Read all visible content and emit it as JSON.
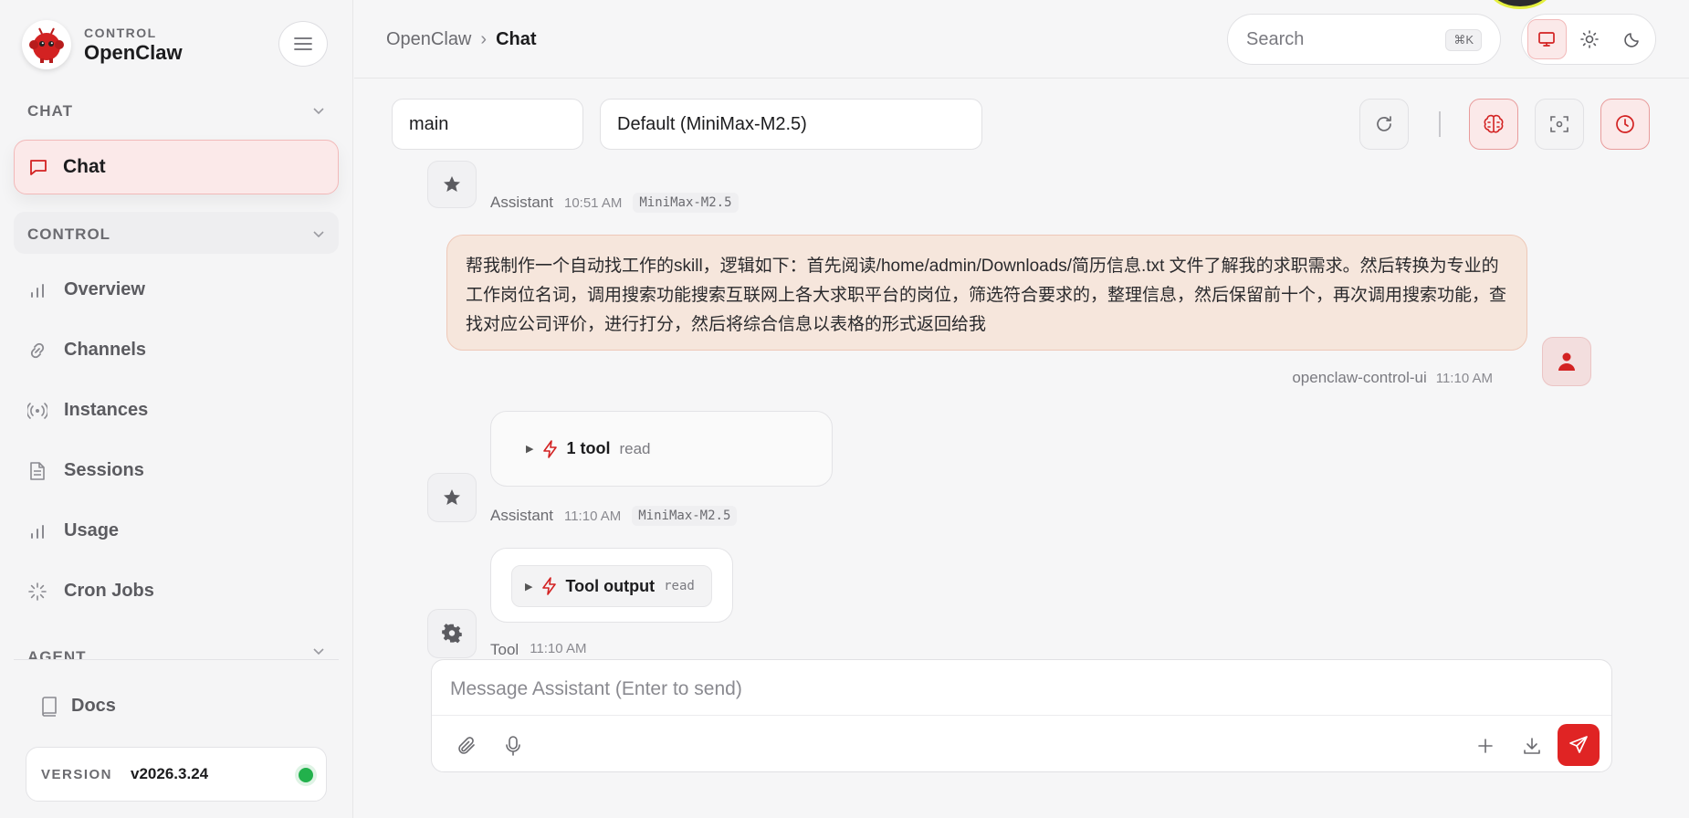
{
  "sidebar": {
    "brand_sub": "CONTROL",
    "brand_name": "OpenClaw",
    "sections": {
      "chat": "CHAT",
      "control": "CONTROL",
      "agent": "AGENT"
    },
    "active_item": "Chat",
    "items": [
      {
        "label": "Overview",
        "icon": "bar-chart-icon"
      },
      {
        "label": "Channels",
        "icon": "link-icon"
      },
      {
        "label": "Instances",
        "icon": "radio-icon"
      },
      {
        "label": "Sessions",
        "icon": "file-icon"
      },
      {
        "label": "Usage",
        "icon": "bar-chart-icon"
      },
      {
        "label": "Cron Jobs",
        "icon": "loader-icon"
      }
    ],
    "docs": "Docs",
    "version_label": "VERSION",
    "version_value": "v2026.3.24",
    "status_color": "#22b14c"
  },
  "topbar": {
    "breadcrumb_root": "OpenClaw",
    "breadcrumb_sep": "›",
    "breadcrumb_current": "Chat",
    "search_placeholder": "Search",
    "search_shortcut": "⌘K"
  },
  "toolbar": {
    "session": "main",
    "model": "Default (MiniMax-M2.5)"
  },
  "messages": {
    "assistant1": {
      "name": "Assistant",
      "time": "10:51 AM",
      "model": "MiniMax-M2.5"
    },
    "user": {
      "text": "帮我制作一个自动找工作的skill，逻辑如下：首先阅读/home/admin/Downloads/简历信息.txt 文件了解我的求职需求。然后转换为专业的工作岗位名词，调用搜索功能搜索互联网上各大求职平台的岗位，筛选符合要求的，整理信息，然后保留前十个，再次调用搜索功能，查找对应公司评价，进行打分，然后将综合信息以表格的形式返回给我",
      "sender": "openclaw-control-ui",
      "time": "11:10 AM"
    },
    "tool_card": {
      "count": "1 tool",
      "name": "read"
    },
    "assistant2": {
      "name": "Assistant",
      "time": "11:10 AM",
      "model": "MiniMax-M2.5"
    },
    "tool_output": {
      "label": "Tool output",
      "name": "read"
    },
    "tool": {
      "name": "Tool",
      "time": "11:10 AM"
    }
  },
  "composer": {
    "placeholder": "Message Assistant (Enter to send)"
  },
  "colors": {
    "accent": "#e02424",
    "accent_soft": "#fbe9e9",
    "user_bubble": "#f6e6dc"
  }
}
